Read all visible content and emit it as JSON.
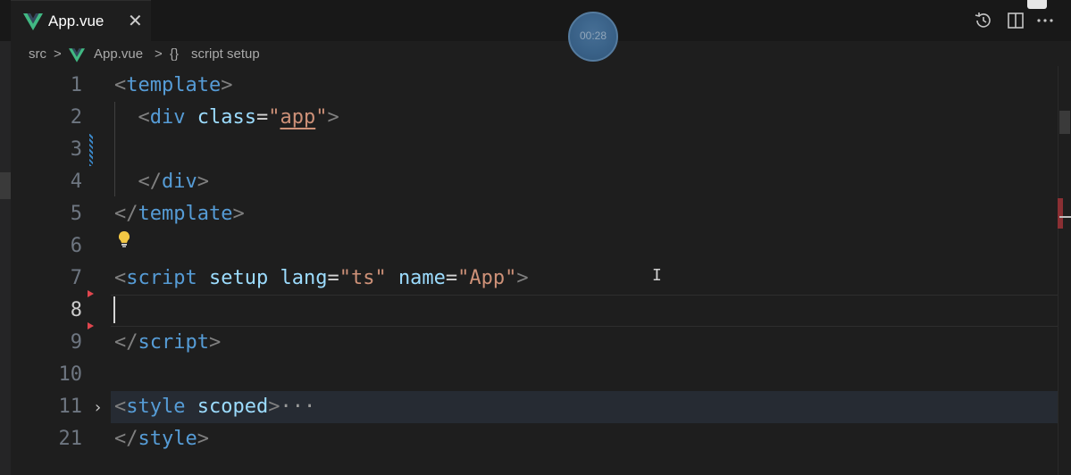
{
  "tab": {
    "file_name": "App.vue",
    "close_glyph": "✕",
    "file_icon": "vue-logo-icon"
  },
  "timer": {
    "label": "00:28"
  },
  "breadcrumb": {
    "folder": "src",
    "sep1": ">",
    "file": "App.vue",
    "sep2": ">",
    "braces": "{}",
    "symbol": "script setup"
  },
  "editor": {
    "lines": [
      {
        "num": "1",
        "tokens": [
          [
            "br",
            "<"
          ],
          [
            "tag",
            "template"
          ],
          [
            "br",
            ">"
          ]
        ]
      },
      {
        "num": "2",
        "tokens": [
          [
            "sp",
            "  "
          ],
          [
            "br",
            "<"
          ],
          [
            "tag",
            "div"
          ],
          [
            "sp",
            " "
          ],
          [
            "attr",
            "class"
          ],
          [
            "eq",
            "="
          ],
          [
            "str",
            "\""
          ],
          [
            "str",
            "app"
          ],
          [
            "str",
            "\""
          ],
          [
            "br",
            ">"
          ]
        ]
      },
      {
        "num": "3",
        "tokens": []
      },
      {
        "num": "4",
        "tokens": [
          [
            "sp",
            "  "
          ],
          [
            "br",
            "</"
          ],
          [
            "tag",
            "div"
          ],
          [
            "br",
            ">"
          ]
        ]
      },
      {
        "num": "5",
        "tokens": [
          [
            "br",
            "</"
          ],
          [
            "tag",
            "template"
          ],
          [
            "br",
            ">"
          ]
        ]
      },
      {
        "num": "6",
        "tokens": []
      },
      {
        "num": "7",
        "tokens": [
          [
            "br",
            "<"
          ],
          [
            "tag",
            "script"
          ],
          [
            "sp",
            " "
          ],
          [
            "attr",
            "setup"
          ],
          [
            "sp",
            " "
          ],
          [
            "attr",
            "lang"
          ],
          [
            "eq",
            "="
          ],
          [
            "str",
            "\"ts\""
          ],
          [
            "sp",
            " "
          ],
          [
            "attr",
            "name"
          ],
          [
            "eq",
            "="
          ],
          [
            "str",
            "\"App\""
          ],
          [
            "br",
            ">"
          ]
        ]
      },
      {
        "num": "8",
        "tokens": []
      },
      {
        "num": "9",
        "tokens": [
          [
            "br",
            "</"
          ],
          [
            "tag",
            "script"
          ],
          [
            "br",
            ">"
          ]
        ]
      },
      {
        "num": "10",
        "tokens": []
      },
      {
        "num": "11",
        "tokens": [
          [
            "br",
            "<"
          ],
          [
            "tag",
            "style"
          ],
          [
            "sp",
            " "
          ],
          [
            "attr",
            "scoped"
          ],
          [
            "br",
            ">"
          ],
          [
            "fold",
            "···"
          ]
        ]
      },
      {
        "num": "21",
        "tokens": [
          [
            "br",
            "</"
          ],
          [
            "tag",
            "style"
          ],
          [
            "br",
            ">"
          ]
        ]
      }
    ],
    "active_line": "8",
    "folded_line": "11"
  },
  "colors": {
    "background": "#1e1e1e",
    "tag": "#569cd6",
    "attribute": "#9cdcfe",
    "string": "#ce9178",
    "bracket": "#808080"
  },
  "toolbar": {
    "icons": [
      "history-icon",
      "split-editor-icon",
      "more-actions-icon"
    ]
  }
}
